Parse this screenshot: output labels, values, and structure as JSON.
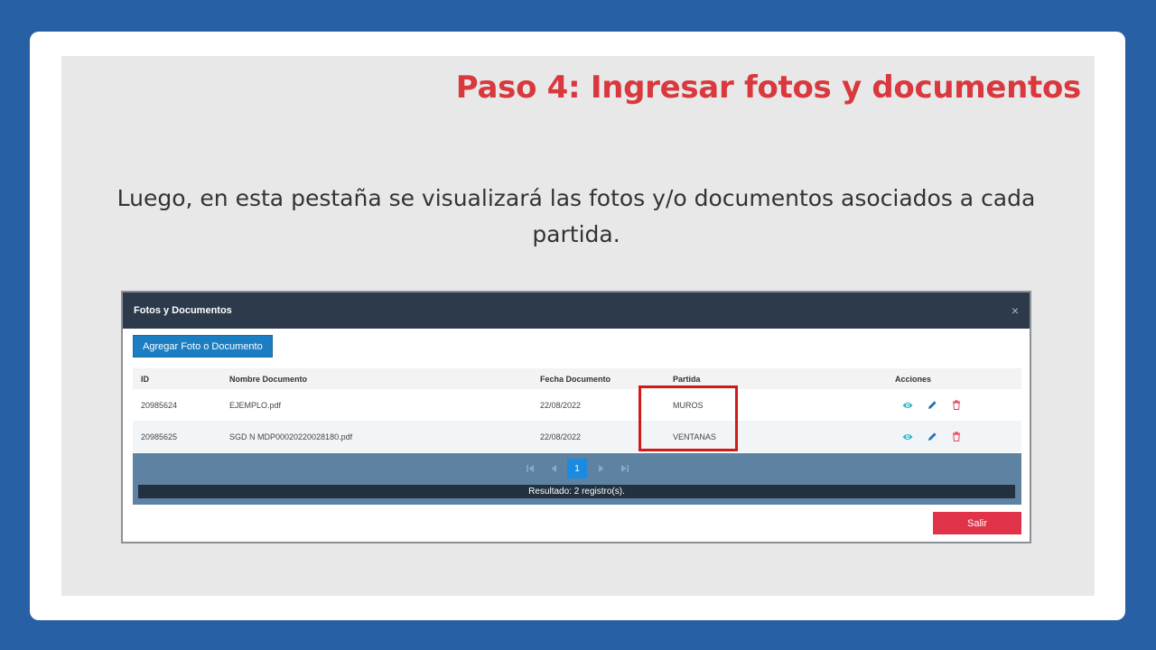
{
  "slide": {
    "title": "Paso 4: Ingresar fotos y documentos",
    "description": "Luego, en esta pestaña se visualizará las fotos y/o documentos asociados a cada partida."
  },
  "modal": {
    "title": "Fotos y Documentos",
    "close_label": "×",
    "add_button_label": "Agregar Foto o Documento",
    "columns": {
      "id": "ID",
      "name": "Nombre Documento",
      "date": "Fecha Documento",
      "partida": "Partida",
      "actions": "Acciones"
    },
    "rows": [
      {
        "id": "20985624",
        "name": "EJEMPLO.pdf",
        "date": "22/08/2022",
        "partida": "MUROS"
      },
      {
        "id": "20985625",
        "name": "SGD N MDP00020220028180.pdf",
        "date": "22/08/2022",
        "partida": "VENTANAS"
      }
    ],
    "row_action_icons": [
      "eye-icon",
      "pencil-icon",
      "trash-icon"
    ],
    "pager": {
      "current_page": "1",
      "result_text": "Resultado: 2 registro(s)."
    },
    "exit_button_label": "Salir"
  },
  "colors": {
    "frame_blue": "#2760a4",
    "title_red": "#d9383e",
    "modal_header": "#2c3a4b",
    "primary_button": "#1b7ec2",
    "danger_button": "#e0334a",
    "pager_bg": "#5d82a2",
    "highlight": "#d11a1a"
  }
}
